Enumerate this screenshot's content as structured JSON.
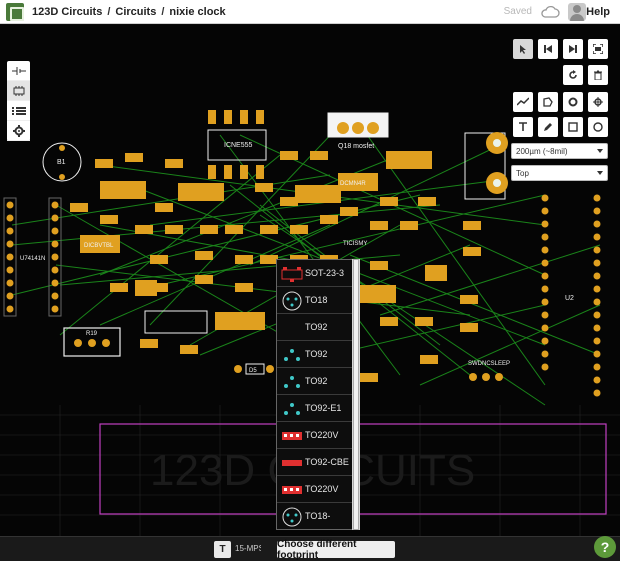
{
  "header": {
    "breadcrumb": [
      "123D Circuits",
      "Circuits",
      "nixie clock"
    ],
    "saved_label": "Saved",
    "help_label": "Help"
  },
  "icons": {
    "logo": "circuits-logo-icon",
    "cloud": "cloud-icon",
    "avatar": "user-avatar-icon"
  },
  "left_tools": [
    {
      "name": "schematic-tool",
      "icon": "battery-symbol-icon"
    },
    {
      "name": "breadboard-tool",
      "icon": "chip-icon"
    },
    {
      "name": "bom-tool",
      "icon": "list-icon"
    },
    {
      "name": "settings-tool",
      "icon": "gear-icon"
    }
  ],
  "right_tools": {
    "row1": [
      "pointer-icon",
      "skip-back-icon",
      "skip-forward-icon",
      "fit-screen-icon"
    ],
    "row2": [
      "rotate-icon",
      "trash-icon"
    ],
    "row3": [
      "route-icon",
      "polygon-icon",
      "via-icon",
      "crosshair-icon"
    ],
    "row4": [
      "text-icon",
      "pen-icon",
      "rectangle-icon",
      "circle-icon"
    ]
  },
  "trace_width": {
    "value": "200µm (~8mil)"
  },
  "layer": {
    "value": "Top"
  },
  "board_labels": {
    "ic": "ICNE555",
    "mosfet": "Q18 mosfet",
    "b1": "B1",
    "u7": "U74141N",
    "u2": "U2",
    "sw": "SWDNCSLEEP",
    "r19": "R19",
    "d5": "D5",
    "mid1": "DCMN4R",
    "mid2": "TICISMY",
    "left1": "DICBVTBL"
  },
  "footprints": [
    {
      "label": "SOT-23-3",
      "icon": "sot23-footprint-icon"
    },
    {
      "label": "TO18",
      "icon": "to18-footprint-icon"
    },
    {
      "label": "TO92",
      "icon": "none"
    },
    {
      "label": "TO92",
      "icon": "to92-footprint-icon"
    },
    {
      "label": "TO92",
      "icon": "to92-footprint-icon"
    },
    {
      "label": "TO92-E1",
      "icon": "to92-footprint-icon"
    },
    {
      "label": "TO220V",
      "icon": "to220-footprint-icon"
    },
    {
      "label": "TO92-CBE",
      "icon": "to92-footprint-icon"
    },
    {
      "label": "TO220V",
      "icon": "to220-footprint-icon"
    },
    {
      "label": "TO18-",
      "icon": "to18-footprint-icon"
    }
  ],
  "bottombar": {
    "text_tool": "T",
    "part": "15-MPS",
    "choose_label": "Choose different footprint",
    "help": "?"
  },
  "colors": {
    "pad": "#e0a020",
    "trace": "#1e9a1e",
    "outline": "#f0f0f0",
    "board_edge": "#c040c0"
  }
}
